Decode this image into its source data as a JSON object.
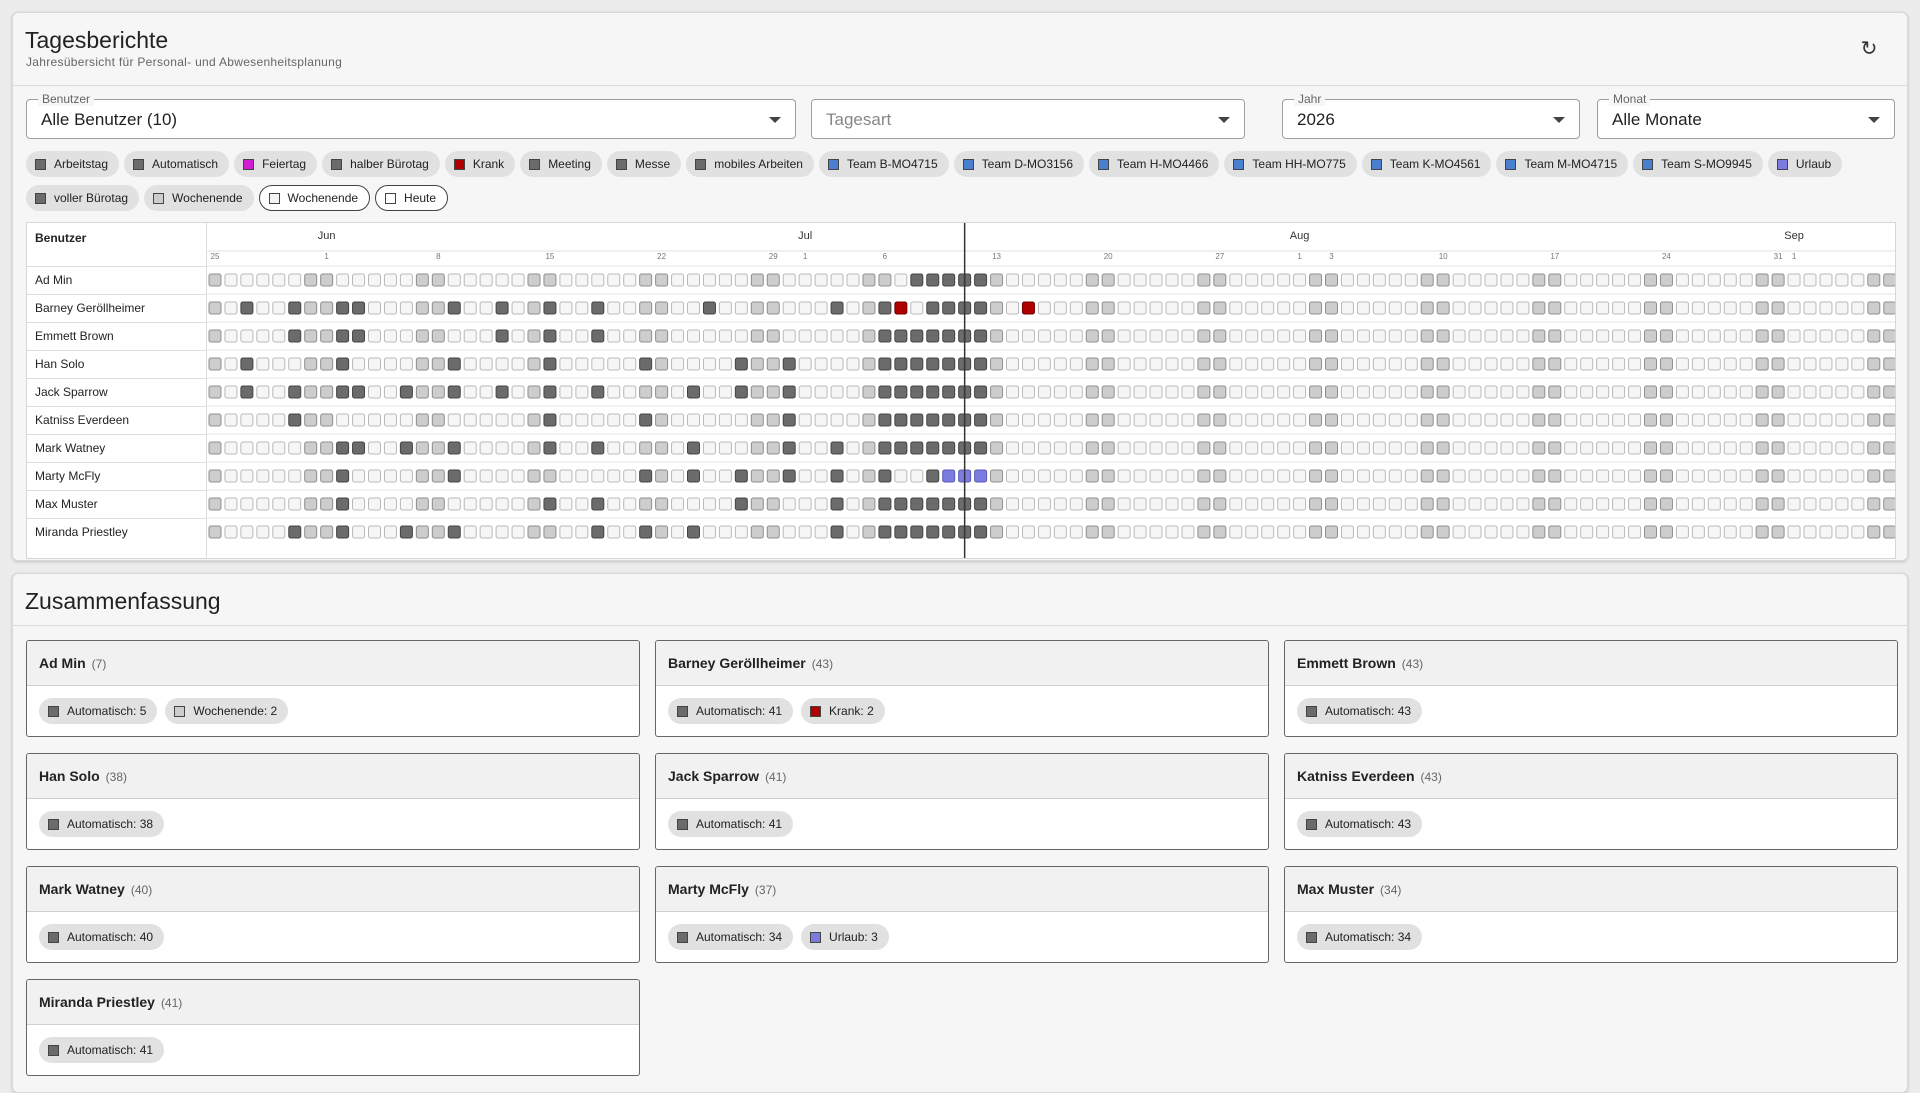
{
  "header": {
    "title": "Tagesberichte",
    "subtitle": "Jahresübersicht für Personal- und Abwesenheitsplanung",
    "refresh_icon": "refresh-icon"
  },
  "filters": {
    "benutzer": {
      "label": "Benutzer",
      "value": "Alle Benutzer (10)"
    },
    "tagesart": {
      "label": "",
      "placeholder": "Tagesart",
      "value": ""
    },
    "jahr": {
      "label": "Jahr",
      "value": "2026"
    },
    "monat": {
      "label": "Monat",
      "value": "Alle Monate"
    }
  },
  "colors": {
    "automatisch": "#6b6b6b",
    "wochenende": "#cdcdcd",
    "krank": "#b00000",
    "urlaub": "#7c7ce0",
    "empty": "#f6f6f6",
    "today_line": "#333333"
  },
  "legend": [
    {
      "label": "Arbeitstag",
      "color": "#6b6b6b",
      "outlined": false
    },
    {
      "label": "Automatisch",
      "color": "#6b6b6b",
      "outlined": false
    },
    {
      "label": "Feiertag",
      "color": "#d21ed2",
      "outlined": false
    },
    {
      "label": "halber Bürotag",
      "color": "#6b6b6b",
      "outlined": false
    },
    {
      "label": "Krank",
      "color": "#b00000",
      "outlined": false
    },
    {
      "label": "Meeting",
      "color": "#6b6b6b",
      "outlined": false
    },
    {
      "label": "Messe",
      "color": "#6b6b6b",
      "outlined": false
    },
    {
      "label": "mobiles Arbeiten",
      "color": "#6b6b6b",
      "outlined": false
    },
    {
      "label": "Team B-MO4715",
      "color": "#4a7fd0",
      "outlined": false
    },
    {
      "label": "Team D-MO3156",
      "color": "#4a7fd0",
      "outlined": false
    },
    {
      "label": "Team H-MO4466",
      "color": "#4a7fd0",
      "outlined": false
    },
    {
      "label": "Team HH-MO775",
      "color": "#4a7fd0",
      "outlined": false
    },
    {
      "label": "Team K-MO4561",
      "color": "#4a7fd0",
      "outlined": false
    },
    {
      "label": "Team M-MO4715",
      "color": "#4a7fd0",
      "outlined": false
    },
    {
      "label": "Team S-MO9945",
      "color": "#4a7fd0",
      "outlined": false
    },
    {
      "label": "Urlaub",
      "color": "#7c7ce0",
      "outlined": false
    },
    {
      "label": "voller Bürotag",
      "color": "#6b6b6b",
      "outlined": false
    },
    {
      "label": "Wochenende",
      "color": "#cdcdcd",
      "outlined": false
    },
    {
      "label": "Wochenende",
      "color": "#f4f4f4",
      "outlined": true
    },
    {
      "label": "Heute",
      "color": "#ffffff",
      "outlined": true
    }
  ],
  "calendar": {
    "users_header": "Benutzer",
    "months": [
      "Jun",
      "Jul",
      "Aug",
      "Sep"
    ],
    "month_day_index": [
      7,
      37,
      68,
      99
    ],
    "week_ticks": [
      {
        "day": 0,
        "label": "25"
      },
      {
        "day": 7,
        "label": "1"
      },
      {
        "day": 14,
        "label": "8"
      },
      {
        "day": 21,
        "label": "15"
      },
      {
        "day": 28,
        "label": "22"
      },
      {
        "day": 35,
        "label": "29"
      },
      {
        "day": 37,
        "label": "1"
      },
      {
        "day": 42,
        "label": "6"
      },
      {
        "day": 49,
        "label": "13"
      },
      {
        "day": 56,
        "label": "20"
      },
      {
        "day": 63,
        "label": "27"
      },
      {
        "day": 68,
        "label": "1"
      },
      {
        "day": 70,
        "label": "3"
      },
      {
        "day": 77,
        "label": "10"
      },
      {
        "day": 84,
        "label": "17"
      },
      {
        "day": 91,
        "label": "24"
      },
      {
        "day": 98,
        "label": "31"
      },
      {
        "day": 99,
        "label": "1"
      }
    ],
    "total_days": 106,
    "today_day": 47,
    "users": [
      {
        "name": "Ad Min",
        "work": [
          44,
          45,
          46,
          47,
          48
        ],
        "sick": [],
        "vacation": []
      },
      {
        "name": "Barney Geröllheimer",
        "work": [
          2,
          5,
          8,
          9,
          15,
          18,
          21,
          24,
          31,
          39,
          42,
          45,
          46,
          47,
          48
        ],
        "sick": [
          43,
          51
        ],
        "vacation": []
      },
      {
        "name": "Emmett Brown",
        "work": [
          5,
          8,
          9,
          18,
          21,
          24,
          42,
          43,
          44,
          45,
          46,
          47,
          48
        ],
        "sick": [],
        "vacation": []
      },
      {
        "name": "Han Solo",
        "work": [
          2,
          8,
          15,
          21,
          27,
          33,
          36,
          42,
          43,
          44,
          45,
          46,
          47,
          48
        ],
        "sick": [],
        "vacation": []
      },
      {
        "name": "Jack Sparrow",
        "work": [
          2,
          5,
          8,
          9,
          12,
          15,
          18,
          21,
          24,
          30,
          33,
          36,
          42,
          43,
          44,
          45,
          46,
          47,
          48
        ],
        "sick": [],
        "vacation": []
      },
      {
        "name": "Katniss Everdeen",
        "work": [
          5,
          21,
          27,
          36,
          42,
          43,
          44,
          45,
          46,
          47,
          48
        ],
        "sick": [],
        "vacation": []
      },
      {
        "name": "Mark Watney",
        "work": [
          8,
          9,
          12,
          15,
          21,
          24,
          30,
          36,
          39,
          42,
          43,
          44,
          45,
          46,
          47,
          48
        ],
        "sick": [],
        "vacation": []
      },
      {
        "name": "Marty McFly",
        "work": [
          8,
          15,
          27,
          30,
          33,
          36,
          39,
          42,
          45,
          46,
          47,
          48
        ],
        "sick": [],
        "vacation": [
          46,
          47,
          48
        ]
      },
      {
        "name": "Max Muster",
        "work": [
          8,
          21,
          24,
          33,
          39,
          42,
          43,
          44,
          45,
          46,
          47,
          48
        ],
        "sick": [],
        "vacation": []
      },
      {
        "name": "Miranda Priestley",
        "work": [
          5,
          8,
          12,
          15,
          24,
          27,
          30,
          39,
          42,
          43,
          44,
          45,
          46,
          47,
          48
        ],
        "sick": [],
        "vacation": []
      }
    ]
  },
  "summary": {
    "title": "Zusammenfassung",
    "cards": [
      {
        "name": "Ad Min",
        "count": "(7)",
        "chips": [
          {
            "label": "Automatisch: 5",
            "color": "#6b6b6b"
          },
          {
            "label": "Wochenende: 2",
            "color": "#cdcdcd"
          }
        ]
      },
      {
        "name": "Barney Geröllheimer",
        "count": "(43)",
        "chips": [
          {
            "label": "Automatisch: 41",
            "color": "#6b6b6b"
          },
          {
            "label": "Krank: 2",
            "color": "#b00000"
          }
        ]
      },
      {
        "name": "Emmett Brown",
        "count": "(43)",
        "chips": [
          {
            "label": "Automatisch: 43",
            "color": "#6b6b6b"
          }
        ]
      },
      {
        "name": "Han Solo",
        "count": "(38)",
        "chips": [
          {
            "label": "Automatisch: 38",
            "color": "#6b6b6b"
          }
        ]
      },
      {
        "name": "Jack Sparrow",
        "count": "(41)",
        "chips": [
          {
            "label": "Automatisch: 41",
            "color": "#6b6b6b"
          }
        ]
      },
      {
        "name": "Katniss Everdeen",
        "count": "(43)",
        "chips": [
          {
            "label": "Automatisch: 43",
            "color": "#6b6b6b"
          }
        ]
      },
      {
        "name": "Mark Watney",
        "count": "(40)",
        "chips": [
          {
            "label": "Automatisch: 40",
            "color": "#6b6b6b"
          }
        ]
      },
      {
        "name": "Marty McFly",
        "count": "(37)",
        "chips": [
          {
            "label": "Automatisch: 34",
            "color": "#6b6b6b"
          },
          {
            "label": "Urlaub: 3",
            "color": "#7c7ce0"
          }
        ]
      },
      {
        "name": "Max Muster",
        "count": "(34)",
        "chips": [
          {
            "label": "Automatisch: 34",
            "color": "#6b6b6b"
          }
        ]
      },
      {
        "name": "Miranda Priestley",
        "count": "(41)",
        "chips": [
          {
            "label": "Automatisch: 41",
            "color": "#6b6b6b"
          }
        ]
      }
    ]
  }
}
